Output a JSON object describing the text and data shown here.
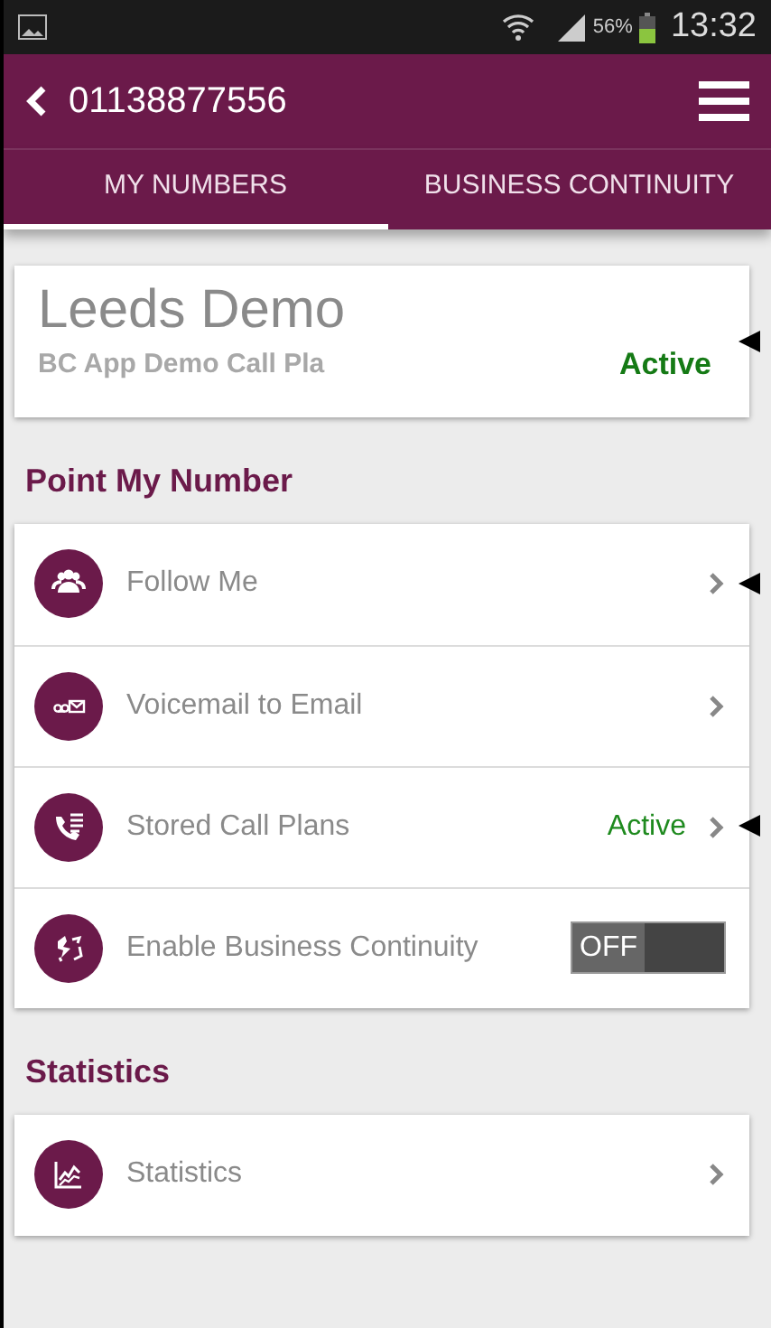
{
  "status_bar": {
    "battery": "56%",
    "time": "13:32"
  },
  "app_bar": {
    "title": "01138877556"
  },
  "tabs": [
    {
      "label": "MY NUMBERS",
      "selected": true
    },
    {
      "label": "BUSINESS CONTINUITY",
      "selected": false
    }
  ],
  "plan_card": {
    "name": "Leeds Demo",
    "plan": "BC App Demo Call Pla",
    "status": "Active",
    "pointer": true
  },
  "sections": [
    {
      "title": "Point My Number",
      "items": [
        {
          "kind": "link",
          "label": "Follow Me",
          "pointer": true
        },
        {
          "kind": "link",
          "label": "Voicemail to Email",
          "pointer": false
        },
        {
          "kind": "link",
          "label": "Stored Call Plans",
          "status": "Active",
          "pointer": true
        },
        {
          "kind": "toggle",
          "label": "Enable Business Continuity",
          "on": false,
          "toggle_text": "OFF"
        }
      ]
    },
    {
      "title": "Statistics",
      "items": [
        {
          "kind": "link",
          "label": "Statistics",
          "pointer": false
        }
      ]
    }
  ]
}
